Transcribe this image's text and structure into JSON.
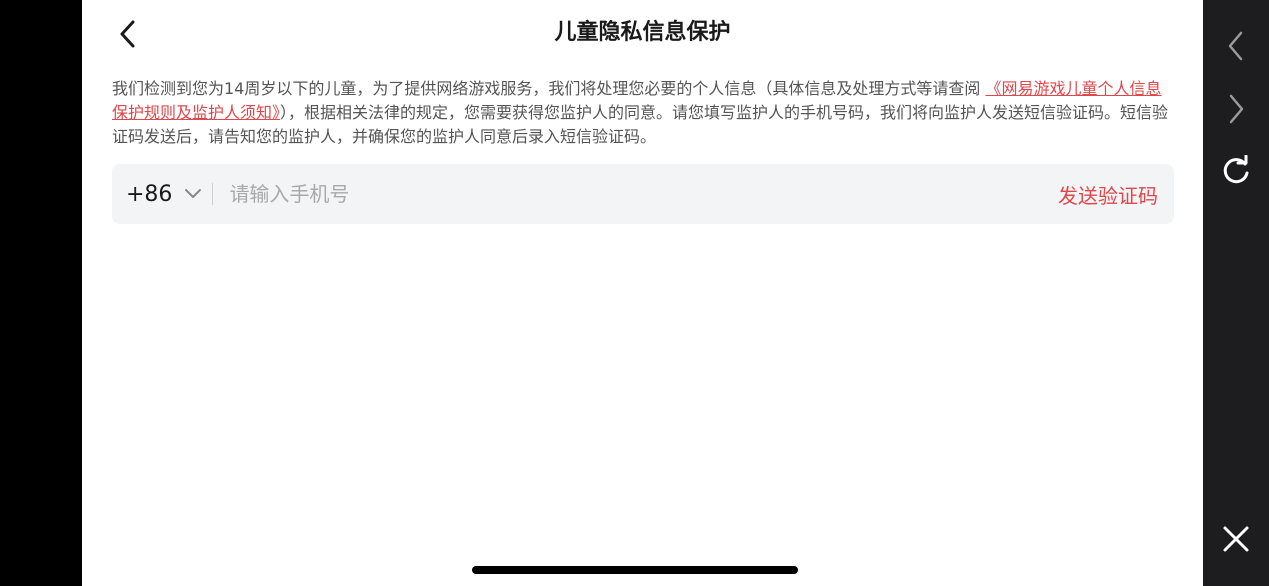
{
  "header": {
    "title": "儿童隐私信息保护"
  },
  "notice": {
    "text_before": "我们检测到您为14周岁以下的儿童，为了提供网络游戏服务，我们将处理您必要的个人信息（具体信息及处理方式等请查阅 ",
    "link": "《网易游戏儿童个人信息保护规则及监护人须知》",
    "text_after": "），根据相关法律的规定，您需要获得您监护人的同意。请您填写监护人的手机号码，我们将向监护人发送短信验证码。短信验证码发送后，请告知您的监护人，并确保您的监护人同意后录入短信验证码。"
  },
  "phone": {
    "country_code": "+86",
    "placeholder": "请输入手机号",
    "value": "",
    "send_label": "发送验证码"
  },
  "colors": {
    "accent": "#e0474b",
    "background": "#ffffff",
    "input_bg": "#f3f4f5"
  },
  "icons": {
    "back": "chevron-left-icon",
    "dropdown": "chevron-down-icon",
    "nav_prev": "chevron-left-icon",
    "nav_next": "chevron-right-icon",
    "refresh": "refresh-icon",
    "close": "close-icon"
  }
}
